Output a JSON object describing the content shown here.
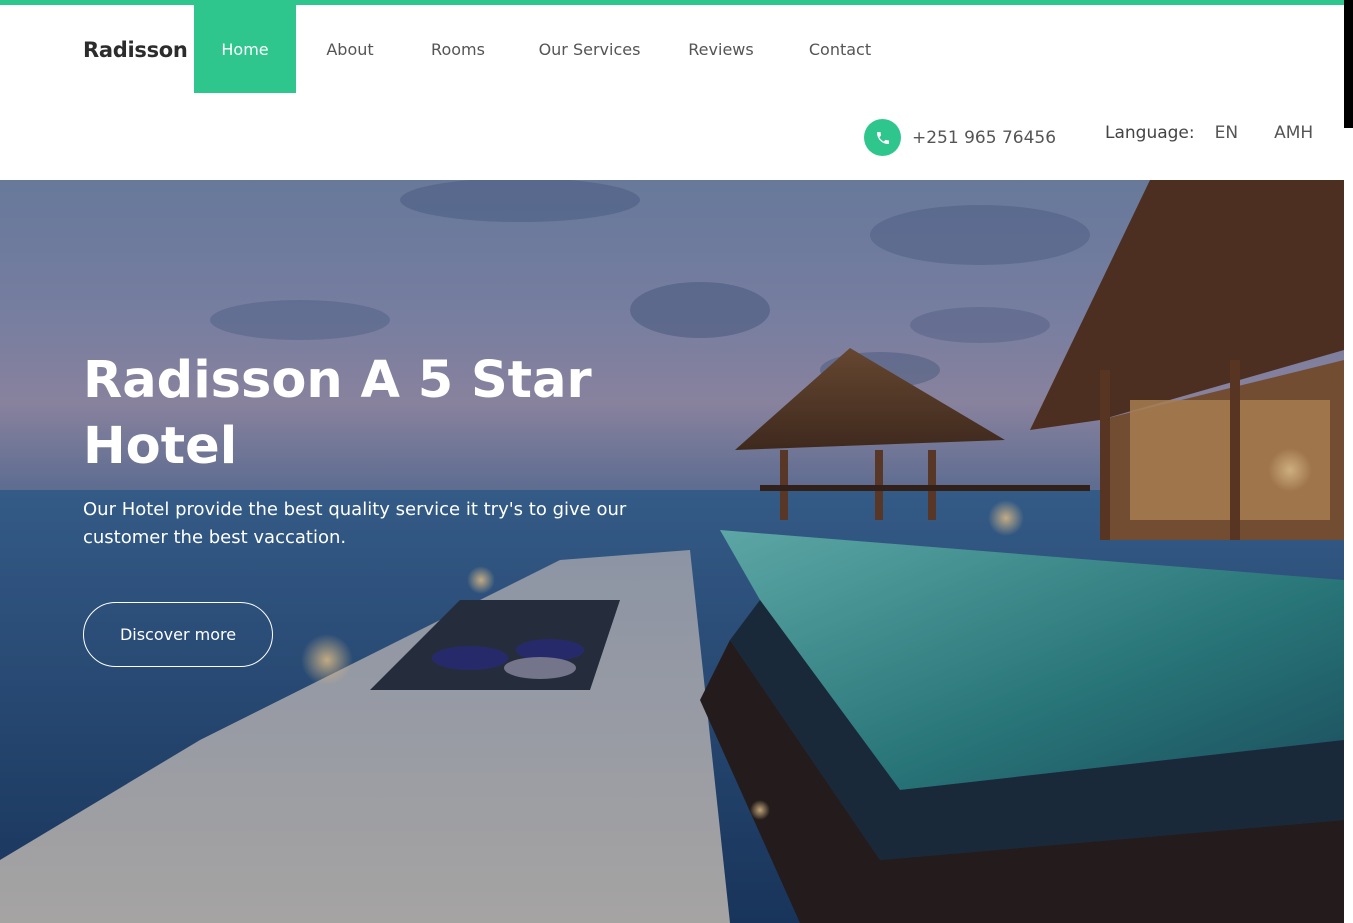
{
  "brand": {
    "name": "Radisson",
    "accent_color": "#2fc68e"
  },
  "nav": {
    "items": [
      {
        "label": "Home",
        "active": true
      },
      {
        "label": "About",
        "active": false
      },
      {
        "label": "Rooms",
        "active": false
      },
      {
        "label": "Our Services",
        "active": false
      },
      {
        "label": "Reviews",
        "active": false
      },
      {
        "label": "Contact",
        "active": false
      }
    ]
  },
  "contact": {
    "phone": "+251 965 76456",
    "icon": "phone-icon"
  },
  "language": {
    "label": "Language:",
    "options": [
      "EN",
      "AMH"
    ]
  },
  "hero": {
    "title": "Radisson A 5 Star Hotel",
    "subtitle": "Our Hotel provide the best quality service it try's to give our customer the best vaccation.",
    "button_label": "Discover more"
  }
}
